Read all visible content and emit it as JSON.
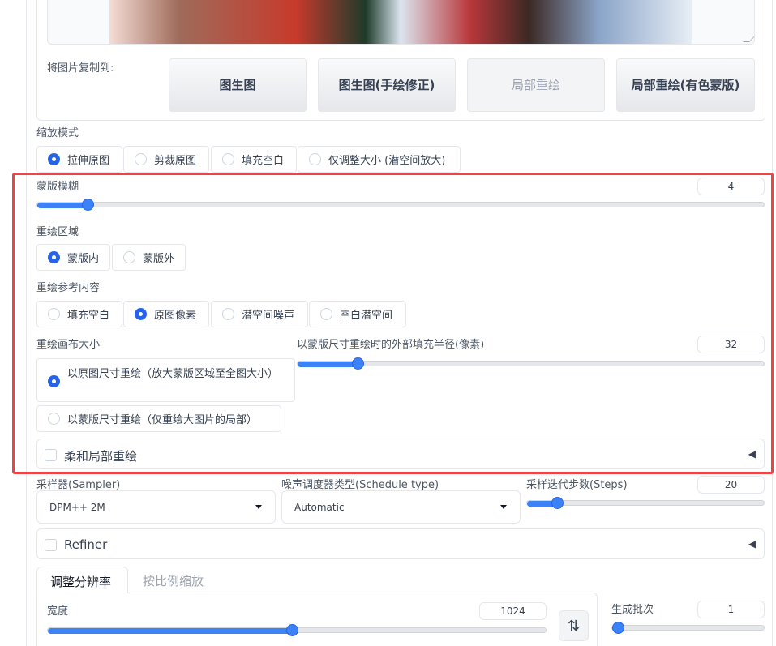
{
  "copy_to": {
    "label": "将图片复制到:",
    "buttons": [
      "图生图",
      "图生图(手绘修正)",
      "局部重绘",
      "局部重绘(有色蒙版)"
    ]
  },
  "resize_mode": {
    "label": "缩放模式",
    "options": [
      "拉伸原图",
      "剪裁原图",
      "填充空白",
      "仅调整大小 (潜空间放大)"
    ],
    "selected": "拉伸原图"
  },
  "mask_blur": {
    "label": "蒙版模糊",
    "value": "4",
    "level": 0.07
  },
  "inpaint_area": {
    "label": "重绘区域",
    "options": [
      "蒙版内",
      "蒙版外"
    ],
    "selected": "蒙版内"
  },
  "inpaint_fill": {
    "label": "重绘参考内容",
    "options": [
      "填充空白",
      "原图像素",
      "潜空间噪声",
      "空白潜空间"
    ],
    "selected": "原图像素"
  },
  "inpaint_full_res": {
    "label": "重绘画布大小",
    "options": [
      "以原图尺寸重绘（放大蒙版区域至全图大小）",
      "以蒙版尺寸重绘（仅重绘大图片的局部）"
    ],
    "selected": "以原图尺寸重绘（放大蒙版区域至全图大小）"
  },
  "padding": {
    "label": "以蒙版尺寸重绘时的外部填充半径(像素)",
    "value": "32",
    "level": 0.13
  },
  "soft_inpaint": {
    "label": "柔和局部重绘",
    "arrow": "◀"
  },
  "sampler": {
    "label": "采样器(Sampler)",
    "value": "DPM++ 2M"
  },
  "schedule": {
    "label": "噪声调度器类型(Schedule type)",
    "value": "Automatic"
  },
  "steps": {
    "label": "采样迭代步数(Steps)",
    "value": "20",
    "level": 0.13
  },
  "refiner": {
    "label": "Refiner",
    "arrow": "◀"
  },
  "size_tabs": {
    "tabs": [
      "调整分辨率",
      "按比例缩放"
    ],
    "active": "调整分辨率"
  },
  "width": {
    "label": "宽度",
    "value": "1024",
    "level": 0.49
  },
  "swap_icon": "⇅",
  "batch_count": {
    "label": "生成批次",
    "value": "1",
    "level": 0.0
  },
  "colors": {
    "accent": "#3b82f6",
    "highlight": "#ef4444"
  }
}
